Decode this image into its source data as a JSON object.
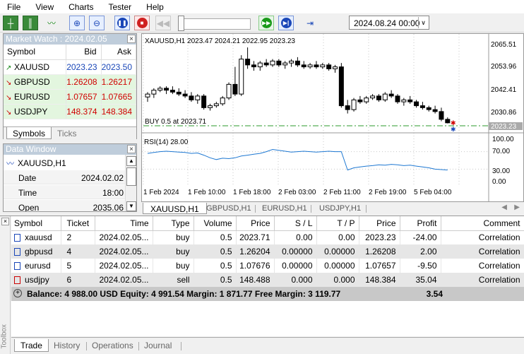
{
  "menu": [
    "File",
    "View",
    "Charts",
    "Tester",
    "Help"
  ],
  "toolbar": {
    "date_value": "2024.08.24 00:00"
  },
  "market_watch": {
    "title": "Market Watch : 2024.02.05",
    "headers": [
      "Symbol",
      "Bid",
      "Ask"
    ],
    "rows": [
      {
        "symbol": "XAUUSD",
        "bid": "2023.23",
        "ask": "2023.50",
        "dir": "up"
      },
      {
        "symbol": "GBPUSD",
        "bid": "1.26208",
        "ask": "1.26217",
        "dir": "down"
      },
      {
        "symbol": "EURUSD",
        "bid": "1.07657",
        "ask": "1.07665",
        "dir": "down"
      },
      {
        "symbol": "USDJPY",
        "bid": "148.374",
        "ask": "148.384",
        "dir": "down"
      }
    ],
    "tabs": [
      "Symbols",
      "Ticks"
    ]
  },
  "data_window": {
    "title": "Data Window",
    "symbol": "XAUUSD,H1",
    "rows": [
      {
        "key": "Date",
        "value": "2024.02.02"
      },
      {
        "key": "Time",
        "value": "18:00"
      },
      {
        "key": "Open",
        "value": "2035.06"
      }
    ]
  },
  "chart": {
    "info": "XAUUSD,H1  2023.47 2024.21 2022.95 2023.23",
    "order_label": "BUY 0.5 at 2023.71",
    "price_labels": [
      "2065.51",
      "2053.96",
      "2042.41",
      "2030.86"
    ],
    "current_price": "2023.23",
    "rsi_label": "RSI(14) 28.00",
    "rsi_labels": [
      "100.00",
      "70.00",
      "30.00",
      "0.00"
    ],
    "time_labels": [
      "1 Feb 2024",
      "1 Feb 10:00",
      "1 Feb 18:00",
      "2 Feb 03:00",
      "2 Feb 11:00",
      "2 Feb 19:00",
      "5 Feb 04:00"
    ],
    "tabs": [
      "XAUUSD,H1",
      "GBPUSD,H1",
      "EURUSD,H1",
      "USDJPY,H1"
    ],
    "colors": {
      "candle": "#000000",
      "rsi": "#1e78d2",
      "order_line": "#2e9a2e",
      "grid": "#c8c8c8"
    }
  },
  "chart_data": {
    "type": "line",
    "title": "",
    "series": [
      {
        "name": "XAUUSD,H1",
        "candles": [
          [
            2036.5,
            2039,
            2034,
            2038
          ],
          [
            2038,
            2041,
            2036,
            2040
          ],
          [
            2040,
            2042,
            2039,
            2041
          ],
          [
            2041,
            2042,
            2038,
            2040
          ],
          [
            2040,
            2042,
            2038,
            2039
          ],
          [
            2039,
            2041,
            2037,
            2038
          ],
          [
            2038,
            2040,
            2036,
            2037
          ],
          [
            2037,
            2039,
            2034,
            2035
          ],
          [
            2035,
            2038,
            2033,
            2037
          ],
          [
            2037,
            2038,
            2030,
            2031
          ],
          [
            2031,
            2033,
            2029.5,
            2032
          ],
          [
            2032,
            2034,
            2031,
            2033
          ],
          [
            2033,
            2037,
            2032,
            2036
          ],
          [
            2036,
            2044,
            2035,
            2043
          ],
          [
            2043,
            2052,
            2037,
            2038
          ],
          [
            2038,
            2058,
            2037,
            2056
          ],
          [
            2056,
            2062,
            2051,
            2053
          ],
          [
            2053,
            2055,
            2050,
            2052
          ],
          [
            2052,
            2055,
            2050,
            2054
          ],
          [
            2054,
            2056,
            2052,
            2053
          ],
          [
            2053,
            2056,
            2052,
            2055
          ],
          [
            2055,
            2056,
            2052,
            2053
          ],
          [
            2053,
            2055,
            2051,
            2054
          ],
          [
            2054,
            2056,
            2052,
            2055
          ],
          [
            2055,
            2057,
            2052,
            2053
          ],
          [
            2053,
            2055,
            2051,
            2052
          ],
          [
            2052,
            2054,
            2051,
            2053
          ],
          [
            2053,
            2055,
            2051,
            2052
          ],
          [
            2052,
            2054,
            2051,
            2053
          ],
          [
            2053,
            2054,
            2050,
            2051
          ],
          [
            2051,
            2053,
            2049,
            2052
          ],
          [
            2052,
            2054,
            2031,
            2032
          ],
          [
            2032,
            2035,
            2028,
            2030
          ],
          [
            2030,
            2036,
            2029,
            2035
          ],
          [
            2035,
            2037,
            2033,
            2034
          ],
          [
            2034,
            2037,
            2033,
            2036
          ],
          [
            2036,
            2038,
            2035,
            2037
          ],
          [
            2037,
            2038,
            2034,
            2035
          ],
          [
            2035,
            2039,
            2034,
            2038
          ],
          [
            2038,
            2040,
            2036,
            2037
          ],
          [
            2037,
            2038,
            2033,
            2034
          ],
          [
            2034,
            2036,
            2032,
            2035
          ],
          [
            2035,
            2037,
            2033,
            2034
          ],
          [
            2034,
            2035,
            2031,
            2032
          ],
          [
            2032,
            2034,
            2030,
            2031
          ],
          [
            2031,
            2032,
            2029,
            2030
          ],
          [
            2030,
            2032,
            2028,
            2029
          ],
          [
            2029,
            2031,
            2024,
            2025
          ],
          [
            2025,
            2026,
            2022.9,
            2023.2
          ]
        ]
      },
      {
        "name": "RSI(14)",
        "values": [
          66,
          68,
          70,
          71,
          70,
          69,
          68,
          66,
          67,
          62,
          56,
          52,
          55,
          54,
          56,
          60,
          62,
          64,
          66,
          70,
          75,
          73,
          71,
          69,
          70,
          71,
          70,
          69,
          70,
          71,
          70,
          70,
          28,
          33,
          35,
          37,
          38,
          40,
          39,
          41,
          40,
          38,
          39,
          37,
          35,
          33,
          30,
          29,
          28
        ]
      }
    ],
    "x": [
      "1 Feb 2024",
      "1 Feb 10:00",
      "1 Feb 18:00",
      "2 Feb 03:00",
      "2 Feb 11:00",
      "2 Feb 19:00",
      "5 Feb 04:00"
    ],
    "ylim": [
      2019.5,
      2067.5
    ],
    "rsi_ylim": [
      0,
      100
    ]
  },
  "trade": {
    "headers": [
      "Symbol",
      "Ticket",
      "Time",
      "Type",
      "Volume",
      "Price",
      "S / L",
      "T / P",
      "Price",
      "Profit",
      "Comment"
    ],
    "rows": [
      {
        "symbol": "xauusd",
        "ticket": "2",
        "time": "2024.02.05...",
        "type": "buy",
        "volume": "0.5",
        "price": "2023.71",
        "sl": "0.00",
        "tp": "0.00",
        "cur": "2023.23",
        "profit": "-24.00",
        "comment": "Correlation"
      },
      {
        "symbol": "gbpusd",
        "ticket": "4",
        "time": "2024.02.05...",
        "type": "buy",
        "volume": "0.5",
        "price": "1.26204",
        "sl": "0.00000",
        "tp": "0.00000",
        "cur": "1.26208",
        "profit": "2.00",
        "comment": "Correlation"
      },
      {
        "symbol": "eurusd",
        "ticket": "5",
        "time": "2024.02.05...",
        "type": "buy",
        "volume": "0.5",
        "price": "1.07676",
        "sl": "0.00000",
        "tp": "0.00000",
        "cur": "1.07657",
        "profit": "-9.50",
        "comment": "Correlation"
      },
      {
        "symbol": "usdjpy",
        "ticket": "6",
        "time": "2024.02.05...",
        "type": "sell",
        "volume": "0.5",
        "price": "148.488",
        "sl": "0.000",
        "tp": "0.000",
        "cur": "148.384",
        "profit": "35.04",
        "comment": "Correlation"
      }
    ],
    "balance": "Balance: 4 988.00 USD  Equity: 4 991.54  Margin: 1 871.77  Free Margin: 3 119.77",
    "balance_profit": "3.54",
    "tabs": [
      "Trade",
      "History",
      "Operations",
      "Journal"
    ],
    "side_label": "Toolbox"
  }
}
